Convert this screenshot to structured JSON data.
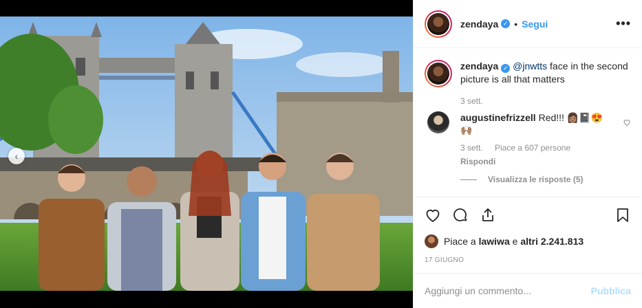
{
  "post": {
    "username": "zendaya",
    "follow_label": "Segui",
    "more_label": "•••",
    "verified_mark": "✓",
    "separator": "•"
  },
  "caption": {
    "username": "zendaya",
    "mention": "@jnwtts",
    "text": " face in the second picture is all that matters",
    "time": "3 sett."
  },
  "comment": {
    "username": "augustinefrizzell",
    "text": "Red!!! 👩🏽📓😍🙌🏽",
    "time": "3 sett.",
    "likes": "Piace a 607 persone",
    "reply": "Rispondi",
    "view_replies": "Visualizza le risposte (5)"
  },
  "likes": {
    "prefix": "Piace a ",
    "user": "lawiwa",
    "middle": " e ",
    "others": "altri 2.241.813"
  },
  "date": "17 GIUGNO",
  "add_comment": {
    "placeholder": "Aggiungi un commento...",
    "publish": "Pubblica"
  },
  "media": {
    "prev_icon": "‹"
  }
}
